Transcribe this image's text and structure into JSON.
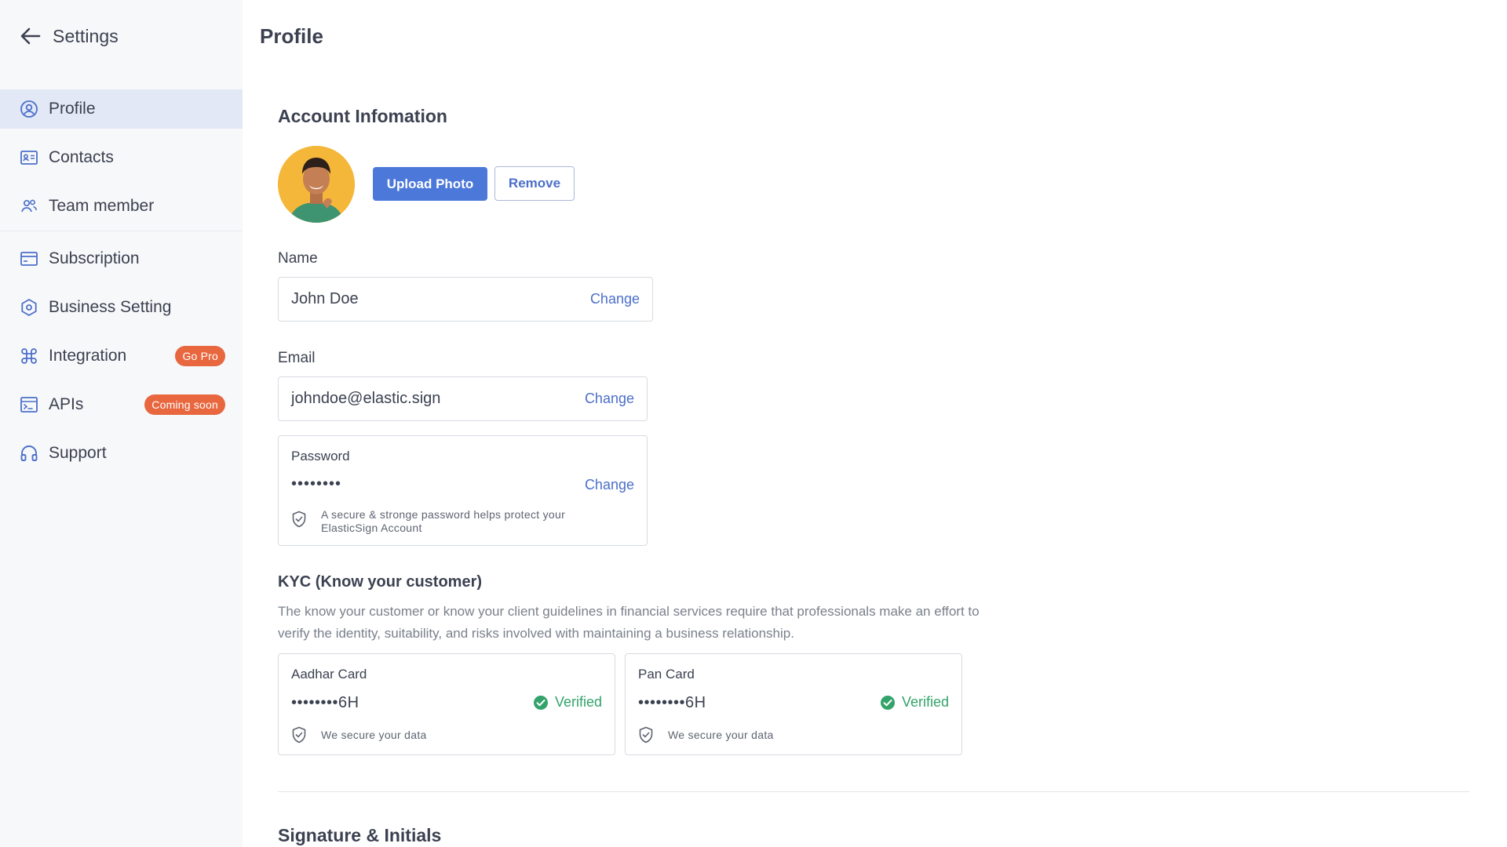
{
  "sidebar": {
    "title": "Settings",
    "items": [
      {
        "label": "Profile",
        "icon": "profile-icon",
        "active": true
      },
      {
        "label": "Contacts",
        "icon": "contacts-icon"
      },
      {
        "label": "Team member",
        "icon": "team-icon"
      },
      {
        "label": "Subscription",
        "icon": "subscription-icon"
      },
      {
        "label": "Business Setting",
        "icon": "business-setting-icon"
      },
      {
        "label": "Integration",
        "icon": "command-icon",
        "badge": "Go Pro"
      },
      {
        "label": "APIs",
        "icon": "terminal-icon",
        "badge": "Coming soon"
      },
      {
        "label": "Support",
        "icon": "headset-icon"
      }
    ]
  },
  "main": {
    "page_title": "Profile",
    "account": {
      "title": "Account Infomation",
      "upload_label": "Upload Photo",
      "remove_label": "Remove"
    },
    "name": {
      "label": "Name",
      "value": "John Doe",
      "change": "Change"
    },
    "email": {
      "label": "Email",
      "value": "johndoe@elastic.sign",
      "change": "Change"
    },
    "password": {
      "label": "Password",
      "value": "••••••••",
      "change": "Change",
      "hint": "A secure & stronge password helps protect your ElasticSign Account"
    },
    "kyc": {
      "title": "KYC (Know your customer)",
      "description": "The know your customer or know your client guidelines in financial services require that professionals make an effort to verify the identity, suitability, and risks involved with maintaining a business relationship.",
      "cards": [
        {
          "name": "Aadhar Card",
          "number": "••••••••6H",
          "status": "Verified",
          "secure": "We secure your data"
        },
        {
          "name": "Pan Card",
          "number": "••••••••6H",
          "status": "Verified",
          "secure": "We secure your data"
        }
      ]
    },
    "signature_title": "Signature & Initials"
  },
  "colors": {
    "accent": "#4c78d9",
    "link": "#4c6fc9",
    "badge": "#e8673f",
    "verified": "#33a36a",
    "sidebar_bg": "#f7f8fa",
    "active_bg": "#e2e8f6"
  }
}
